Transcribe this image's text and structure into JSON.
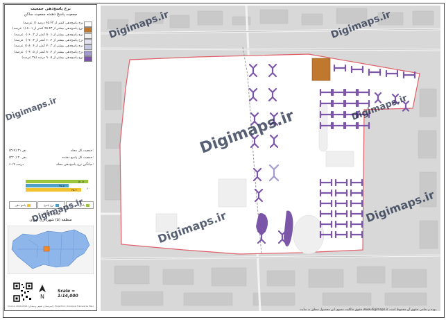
{
  "panel": {
    "title_line1": "نرخ پاسخ‌دهی جمعیت",
    "title_line2": "جمعیت پاسخ دهنده جمعیت ساکن",
    "legend_items": [
      {
        "label": "نرخ پاسخ‌دهی کمتر از ۴۵.۴۳ درصد (۱ عرصه)",
        "color": "#ffffff"
      },
      {
        "label": "نرخ پاسخ‌دهی بیشتر از ۴۵.۴۳ کمتر از ۵۰.۱ (۱ عرصه)",
        "color": "#c0782f"
      },
      {
        "label": "نرخ پاسخ‌دهی بیشتر از ۵۰.۱ کمتر از ۶۰.۲ (۰ عرصه)",
        "color": "#efefef"
      },
      {
        "label": "نرخ پاسخ‌دهی بیشتر از ۶۰.۲ کمتر از ۷۰.۳ (۰ عرصه)",
        "color": "#e2e2ee"
      },
      {
        "label": "نرخ پاسخ‌دهی بیشتر از ۷۰.۳ کمتر از ۸۰.۴ (۱ عرصه)",
        "color": "#c7c6e0"
      },
      {
        "label": "نرخ پاسخ‌دهی بیشتر از ۸۰.۴ کمتر از ۹۰.۵ (۰ عرصه)",
        "color": "#a39bd0"
      },
      {
        "label": "نرخ پاسخ‌دهی بیشتر از ۹۰.۵ درصد (۳۸ عرصه)",
        "color": "#7b55a8"
      }
    ],
    "stats": [
      {
        "key": "جمعیت کل محله:",
        "value": "(۳۶۴) ۳۱ نفر"
      },
      {
        "key": "جمعیت کل پاسخ دهنده:",
        "value": "(۲۲۰) ۲۰ نفر"
      },
      {
        "key": "میانگین نرخ پاسخ‌دهی محله:",
        "value": "۶۰/۴ درصد"
      }
    ],
    "bars": [
      {
        "value_label": "۵۱.۵",
        "fraction": 0.45,
        "color": "#9ac43a"
      },
      {
        "value_label": "۳۵.۵",
        "fraction": 0.31,
        "color": "#4fa0c8"
      },
      {
        "value_label": "۴۵.۴",
        "fraction": 0.4,
        "color": "#f2c12e"
      }
    ],
    "bar_axis_label": "۶۰",
    "bar_legend": [
      {
        "label": "پاسخ دهی کل",
        "color": "#9ac43a"
      },
      {
        "label": "نرخ پاسخ",
        "color": "#4fa0c8"
      },
      {
        "label": "پاسخ دهی",
        "color": "#f2c12e"
      }
    ],
    "neighborhood": "محله اکباتان",
    "district": "منطقه (۵) شهرداری تهران",
    "scale": "Scale = 1:14,000",
    "small_caption": "Source: 2016-2021 (سرشماری نفوس و مسکن) / Projection: Universal Transverse Mercator"
  },
  "watermark": "Digimaps.ir",
  "footer": "حقوق مالکیت معنوی این محصول متعلق به سایت www.digimaps.ir بوده و تمامی حقوق آن محفوظ است."
}
